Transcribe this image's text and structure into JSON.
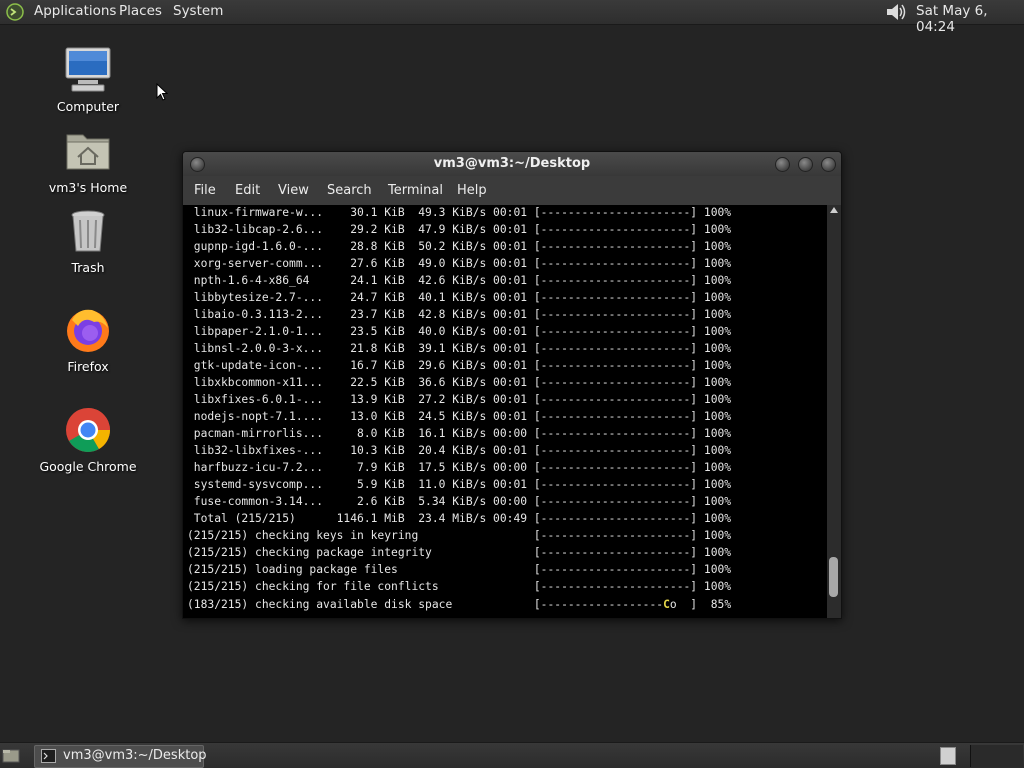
{
  "top_panel": {
    "menus": [
      "Applications",
      "Places",
      "System"
    ],
    "clock": "Sat May  6, 04:24"
  },
  "desktop_icons": [
    {
      "label": "Computer",
      "icon": "computer-icon"
    },
    {
      "label": "vm3's Home",
      "icon": "home-folder-icon"
    },
    {
      "label": "Trash",
      "icon": "trash-icon"
    },
    {
      "label": "Firefox",
      "icon": "firefox-icon"
    },
    {
      "label": "Google Chrome",
      "icon": "chrome-icon"
    }
  ],
  "terminal": {
    "title": "vm3@vm3:~/Desktop",
    "menu": [
      "File",
      "Edit",
      "View",
      "Search",
      "Terminal",
      "Help"
    ],
    "lines": [
      " linux-firmware-w...    30.1 KiB  49.3 KiB/s 00:01 [----------------------] 100%",
      " lib32-libcap-2.6...    29.2 KiB  47.9 KiB/s 00:01 [----------------------] 100%",
      " gupnp-igd-1.6.0-...    28.8 KiB  50.2 KiB/s 00:01 [----------------------] 100%",
      " xorg-server-comm...    27.6 KiB  49.0 KiB/s 00:01 [----------------------] 100%",
      " npth-1.6-4-x86_64      24.1 KiB  42.6 KiB/s 00:01 [----------------------] 100%",
      " libbytesize-2.7-...    24.7 KiB  40.1 KiB/s 00:01 [----------------------] 100%",
      " libaio-0.3.113-2...    23.7 KiB  42.8 KiB/s 00:01 [----------------------] 100%",
      " libpaper-2.1.0-1...    23.5 KiB  40.0 KiB/s 00:01 [----------------------] 100%",
      " libnsl-2.0.0-3-x...    21.8 KiB  39.1 KiB/s 00:01 [----------------------] 100%",
      " gtk-update-icon-...    16.7 KiB  29.6 KiB/s 00:01 [----------------------] 100%",
      " libxkbcommon-x11...    22.5 KiB  36.6 KiB/s 00:01 [----------------------] 100%",
      " libxfixes-6.0.1-...    13.9 KiB  27.2 KiB/s 00:01 [----------------------] 100%",
      " nodejs-nopt-7.1....    13.0 KiB  24.5 KiB/s 00:01 [----------------------] 100%",
      " pacman-mirrorlis...     8.0 KiB  16.1 KiB/s 00:00 [----------------------] 100%",
      " lib32-libxfixes-...    10.3 KiB  20.4 KiB/s 00:01 [----------------------] 100%",
      " harfbuzz-icu-7.2...     7.9 KiB  17.5 KiB/s 00:00 [----------------------] 100%",
      " systemd-sysvcomp...     5.9 KiB  11.0 KiB/s 00:01 [----------------------] 100%",
      " fuse-common-3.14...     2.6 KiB  5.34 KiB/s 00:00 [----------------------] 100%",
      " Total (215/215)      1146.1 MiB  23.4 MiB/s 00:49 [----------------------] 100%",
      "(215/215) checking keys in keyring                 [----------------------] 100%",
      "(215/215) checking package integrity               [----------------------] 100%",
      "(215/215) loading package files                    [----------------------] 100%",
      "(215/215) checking for file conflicts              [----------------------] 100%"
    ],
    "last_line_prefix": "(183/215) checking available disk space            [------------------",
    "last_line_pacman": "C",
    "last_line_suffix": "o  ]  85%"
  },
  "bottom_panel": {
    "task_label": "vm3@vm3:~/Desktop"
  }
}
